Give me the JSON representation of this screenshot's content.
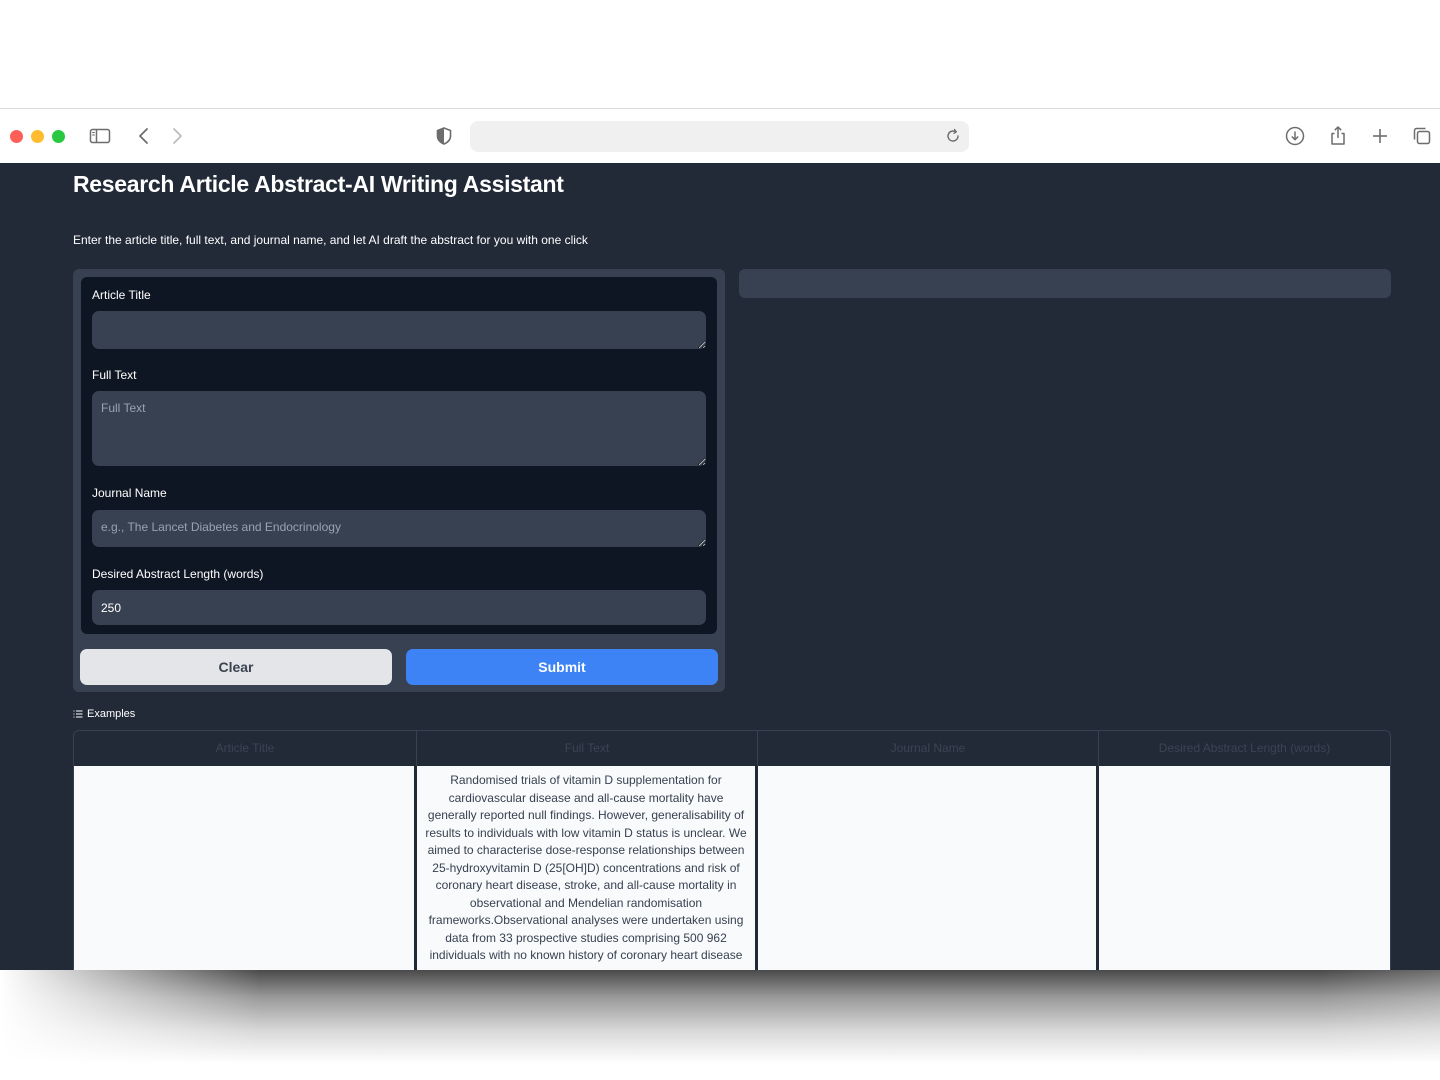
{
  "browser": {
    "address": ""
  },
  "app": {
    "title": "Research Article Abstract-AI Writing Assistant",
    "description": "Enter the article title, full text, and journal name, and let AI draft the abstract for you with one click"
  },
  "form": {
    "article_title": {
      "label": "Article Title",
      "value": "",
      "placeholder": ""
    },
    "full_text": {
      "label": "Full Text",
      "value": "",
      "placeholder": "Full Text"
    },
    "journal_name": {
      "label": "Journal Name",
      "value": "",
      "placeholder": "e.g., The Lancet Diabetes and Endocrinology"
    },
    "abstract_length": {
      "label": "Desired Abstract Length (words)",
      "value": "250"
    },
    "clear_label": "Clear",
    "submit_label": "Submit"
  },
  "output": {
    "value": ""
  },
  "examples": {
    "label": "Examples",
    "headers": [
      "Article Title",
      "Full Text",
      "Journal Name",
      "Desired Abstract Length (words)"
    ],
    "rows": [
      {
        "article_title": "",
        "full_text": "Randomised trials of vitamin D supplementation for cardiovascular disease and all-cause mortality have generally reported null findings. However, generalisability of results to individuals with low vitamin D status is unclear. We aimed to characterise dose-response relationships between 25-hydroxyvitamin D (25[OH]D) concentrations and risk of coronary heart disease, stroke, and all-cause mortality in observational and Mendelian randomisation frameworks.Observational analyses were undertaken using data from 33 prospective studies comprising 500 962 individuals with no known history of coronary heart disease",
        "journal_name": "",
        "abstract_length": ""
      }
    ]
  },
  "colors": {
    "app_background": "#222a38",
    "panel": "#384152",
    "form_inner": "#0f1623",
    "submit": "#3d83f6",
    "clear": "#e4e5e8"
  },
  "icons": {
    "sidebar": "sidebar-icon",
    "back": "chevron-left-icon",
    "forward": "chevron-right-icon",
    "shield": "shield-icon",
    "reload": "reload-icon",
    "download": "download-icon",
    "share": "share-icon",
    "new_tab": "plus-icon",
    "tabs": "tabs-overview-icon",
    "examples": "list-icon"
  }
}
